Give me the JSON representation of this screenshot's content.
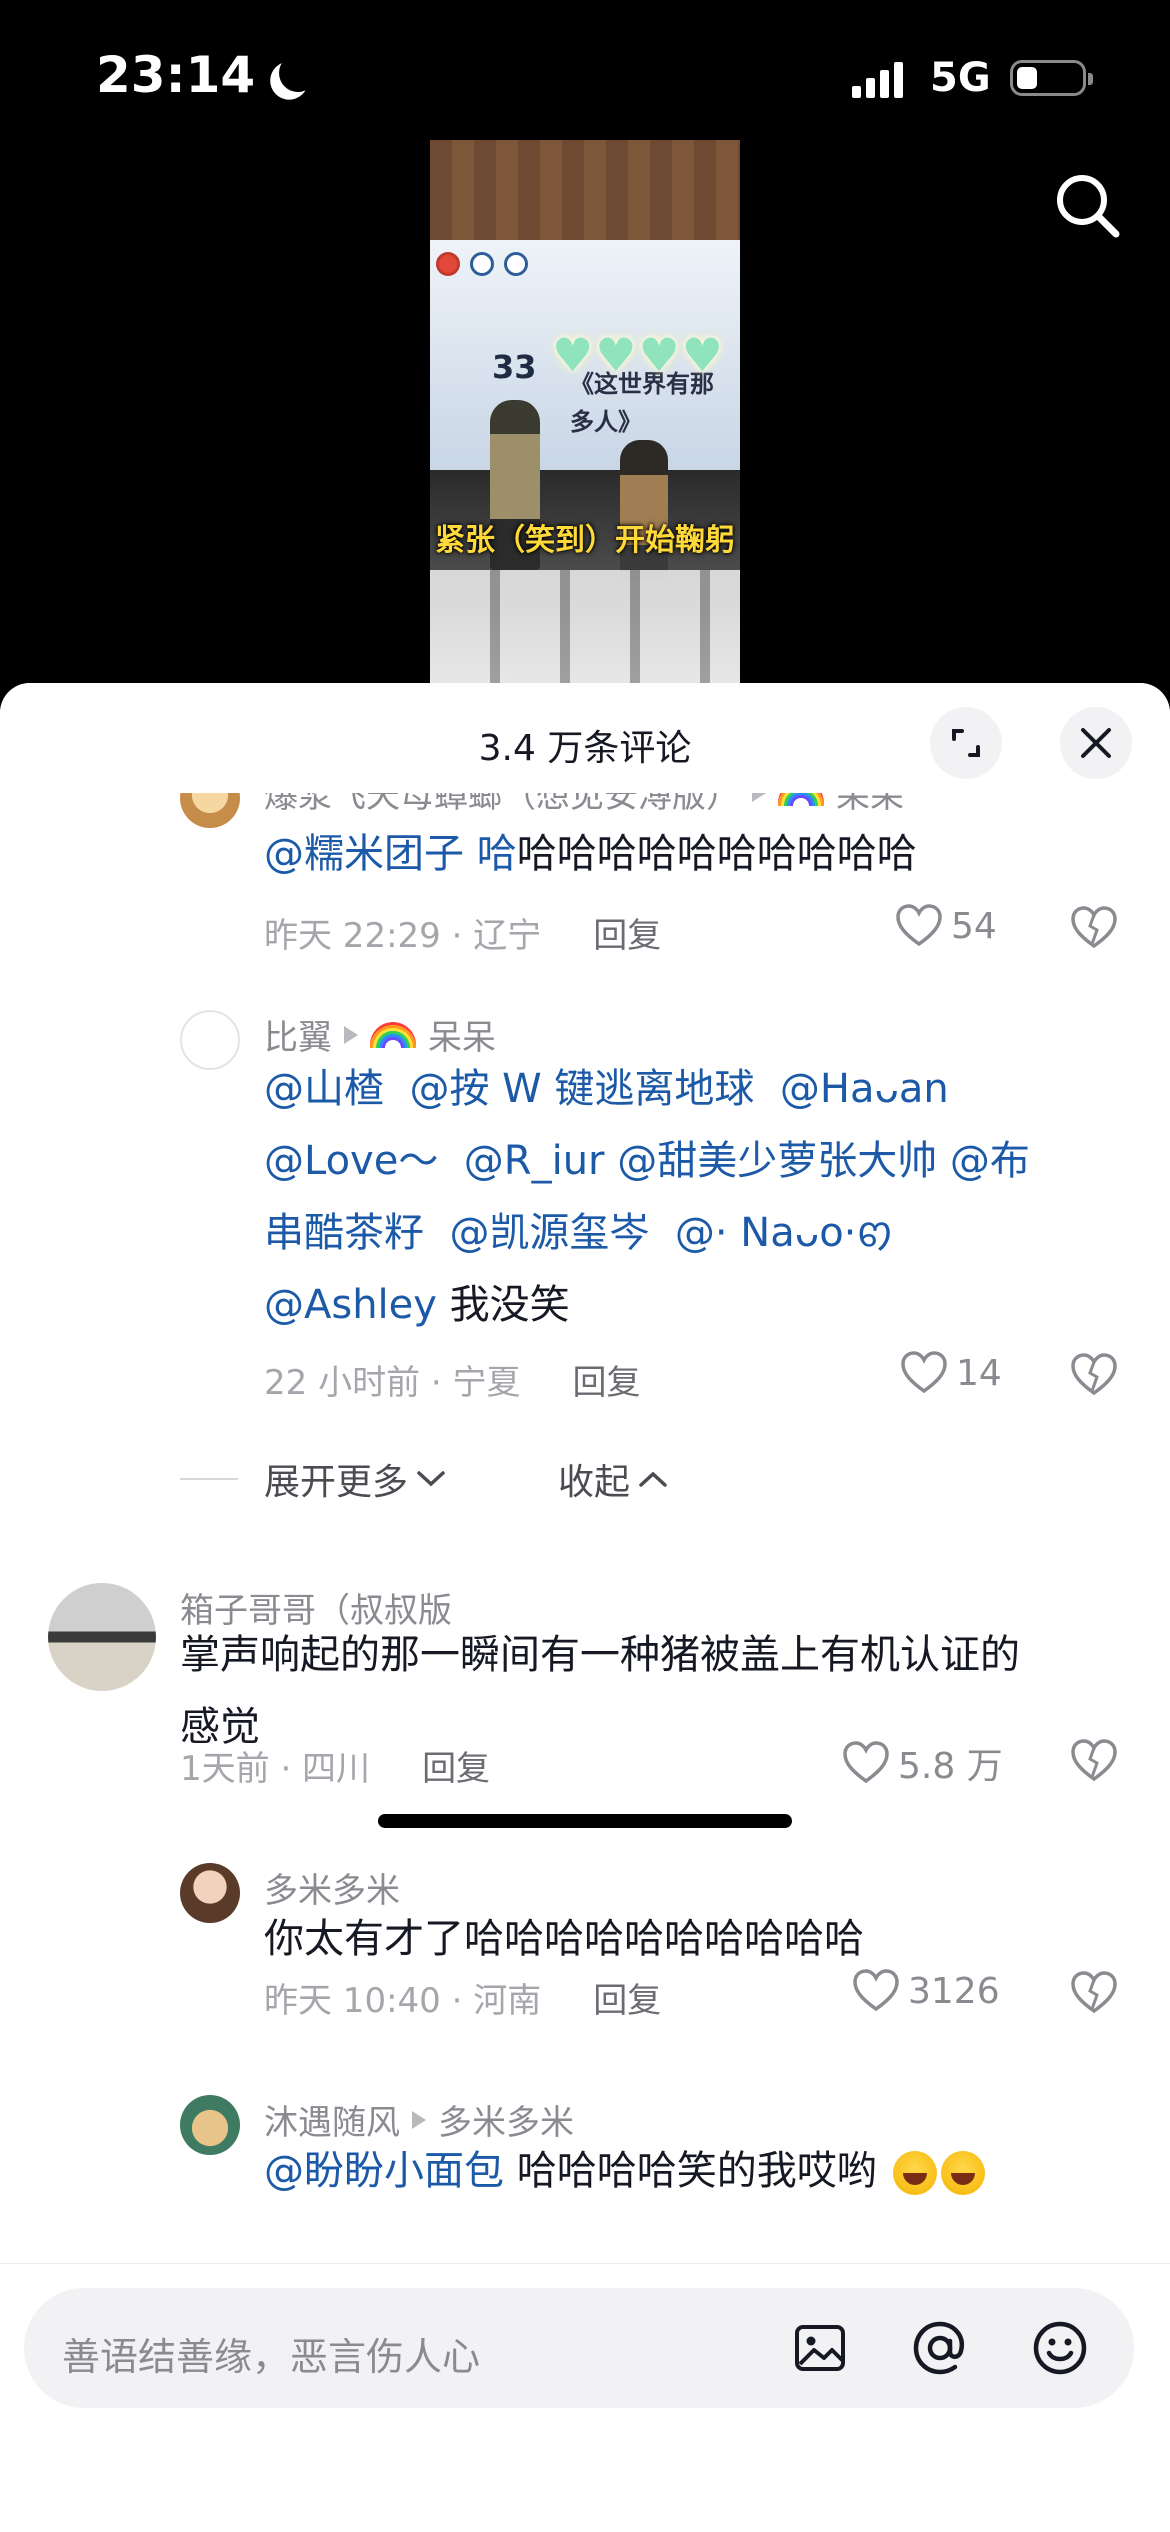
{
  "status_bar": {
    "time": "23:14",
    "network": "5G"
  },
  "video": {
    "caption": "紧张（笑到）开始鞠躬",
    "banner_number": "33",
    "banner_text_1": "《这世界有那",
    "banner_text_2": "多人》"
  },
  "sheet": {
    "title": "3.4 万条评论"
  },
  "comments": [
    {
      "user": "爆浆飞天母蟑螂（想见安溥版）",
      "reply_to": "呆呆",
      "mentions": [
        "@糯米团子"
      ],
      "text_tail": "哈哈哈哈哈哈哈哈哈哈",
      "mention_ha": "哈",
      "time": "昨天 22:29 · 辽宁",
      "reply_label": "回复",
      "likes": "54"
    },
    {
      "user": "比翼",
      "reply_to": "呆呆",
      "line1": [
        "@山楂",
        "@按 W 键逃离地球",
        "@Haᴗan"
      ],
      "line2": [
        "@Love～",
        "@R_iur",
        "@甜美少萝张大帅",
        "@布"
      ],
      "line3": [
        "串酷茶籽",
        "@凯源玺岑",
        "@· Naᴗo·ꩅ"
      ],
      "line4_mention": "@Ashley",
      "line4_text": " 我没笑",
      "time": "22 小时前 · 宁夏",
      "reply_label": "回复",
      "likes": "14"
    },
    {
      "expand_label": "展开更多",
      "collapse_label": "收起"
    },
    {
      "user": "箱子哥哥（叔叔版",
      "text_line1": "掌声响起的那一瞬间有一种猪被盖上有机认证的",
      "text_line2": "感觉",
      "time": "1天前 · 四川",
      "reply_label": "回复",
      "likes": "5.8 万"
    },
    {
      "user": "多米多米",
      "text": "你太有才了哈哈哈哈哈哈哈哈哈哈",
      "time": "昨天 10:40 · 河南",
      "reply_label": "回复",
      "likes": "3126"
    },
    {
      "user": "沐遇随风",
      "reply_to": "多米多米",
      "mention": "@盼盼小面包",
      "text": " 哈哈哈哈笑的我哎哟"
    }
  ],
  "input": {
    "placeholder": "善语结善缘，恶言伤人心"
  },
  "icons": [
    "moon-icon",
    "signal-icon",
    "battery-icon",
    "search-icon",
    "expand-icon",
    "close-icon",
    "heart-icon",
    "dislike-icon",
    "chevron-down-icon",
    "chevron-up-icon",
    "image-icon",
    "at-icon",
    "emoji-icon"
  ]
}
